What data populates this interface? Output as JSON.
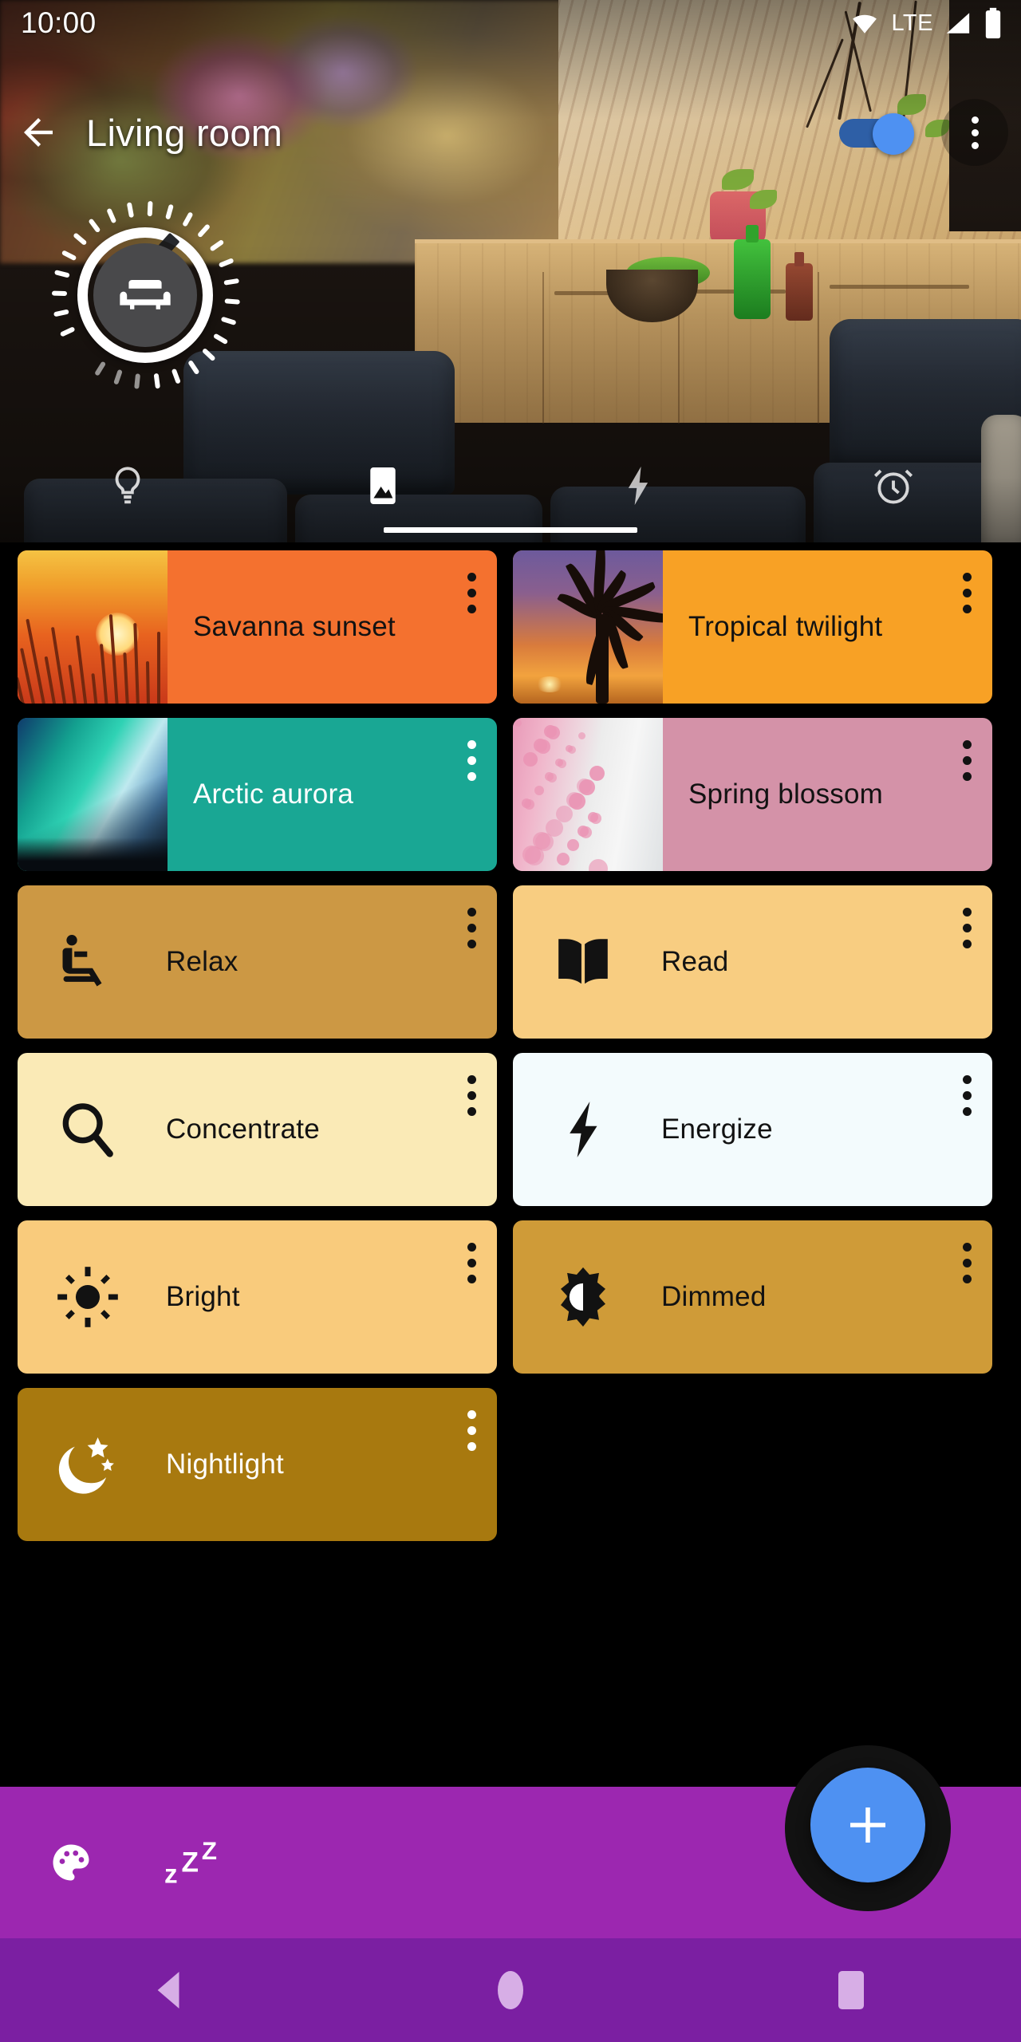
{
  "statusbar": {
    "clock": "10:00",
    "network_label": "LTE",
    "icons": [
      "wifi-icon",
      "signal-icon",
      "battery-icon"
    ]
  },
  "appbar": {
    "back_icon": "back-arrow-icon",
    "title": "Living room",
    "toggle": {
      "name": "room-power-toggle",
      "state": "on",
      "on_color": "#4e91f2",
      "track_color": "#2e5fa6"
    },
    "overflow_icon": "overflow-menu-icon"
  },
  "dial": {
    "name": "brightness-dial",
    "icon": "sofa-icon",
    "brightness_percent": 88,
    "ring_color": "#ffffff",
    "inner_color": "#49494b"
  },
  "tabs": {
    "active_index": 1,
    "items": [
      {
        "icon": "lightbulb-icon",
        "name": "tab-lights",
        "active": false
      },
      {
        "icon": "image-icon",
        "name": "tab-scenes",
        "active": true
      },
      {
        "icon": "bolt-icon",
        "name": "tab-power",
        "active": false
      },
      {
        "icon": "alarm-clock-icon",
        "name": "tab-schedules",
        "active": false
      }
    ]
  },
  "scenes": [
    {
      "label": "Savanna sunset",
      "bg": "#f4712f",
      "text": "#121212",
      "dots": "#121212",
      "thumb": "savanna-thumbnail",
      "icon": null
    },
    {
      "label": "Tropical twilight",
      "bg": "#f8a125",
      "text": "#121212",
      "dots": "#121212",
      "thumb": "tropical-thumbnail",
      "icon": null
    },
    {
      "label": "Arctic aurora",
      "bg": "#19a794",
      "text": "#ffffff",
      "dots": "#ffffff",
      "thumb": "aurora-thumbnail",
      "icon": null
    },
    {
      "label": "Spring blossom",
      "bg": "#d492a8",
      "text": "#121212",
      "dots": "#121212",
      "thumb": "blossom-thumbnail",
      "icon": null
    },
    {
      "label": "Relax",
      "bg": "#cc9844",
      "text": "#121212",
      "dots": "#121212",
      "thumb": null,
      "icon": "recliner-icon"
    },
    {
      "label": "Read",
      "bg": "#f8cd81",
      "text": "#121212",
      "dots": "#121212",
      "thumb": null,
      "icon": "open-book-icon"
    },
    {
      "label": "Concentrate",
      "bg": "#faeab6",
      "text": "#121212",
      "dots": "#121212",
      "thumb": null,
      "icon": "magnifier-icon"
    },
    {
      "label": "Energize",
      "bg": "#f3fbfd",
      "text": "#121212",
      "dots": "#121212",
      "thumb": null,
      "icon": "bolt-icon"
    },
    {
      "label": "Bright",
      "bg": "#f9cb7c",
      "text": "#121212",
      "dots": "#121212",
      "thumb": null,
      "icon": "sun-icon"
    },
    {
      "label": "Dimmed",
      "bg": "#cf9b38",
      "text": "#121212",
      "dots": "#121212",
      "thumb": null,
      "icon": "half-brightness-icon"
    },
    {
      "label": "Nightlight",
      "bg": "#a8790f",
      "text": "#ffffff",
      "dots": "#ffffff",
      "thumb": null,
      "icon": "moon-stars-icon"
    }
  ],
  "bottombar": {
    "color": "#9c27b0",
    "actions": [
      {
        "icon": "palette-icon",
        "name": "color-picker-button"
      },
      {
        "icon": "sleep-zzz-icon",
        "name": "sleep-button",
        "text": "zZ"
      }
    ],
    "fab": {
      "icon": "plus-icon",
      "name": "add-scene-fab",
      "color": "#4e91f2"
    }
  },
  "navbar": {
    "color": "#7b1fa2",
    "icon_color": "#d7aee6",
    "buttons": [
      {
        "icon": "nav-back-icon",
        "name": "android-back-button"
      },
      {
        "icon": "nav-home-icon",
        "name": "android-home-button"
      },
      {
        "icon": "nav-recents-icon",
        "name": "android-recents-button"
      }
    ]
  }
}
